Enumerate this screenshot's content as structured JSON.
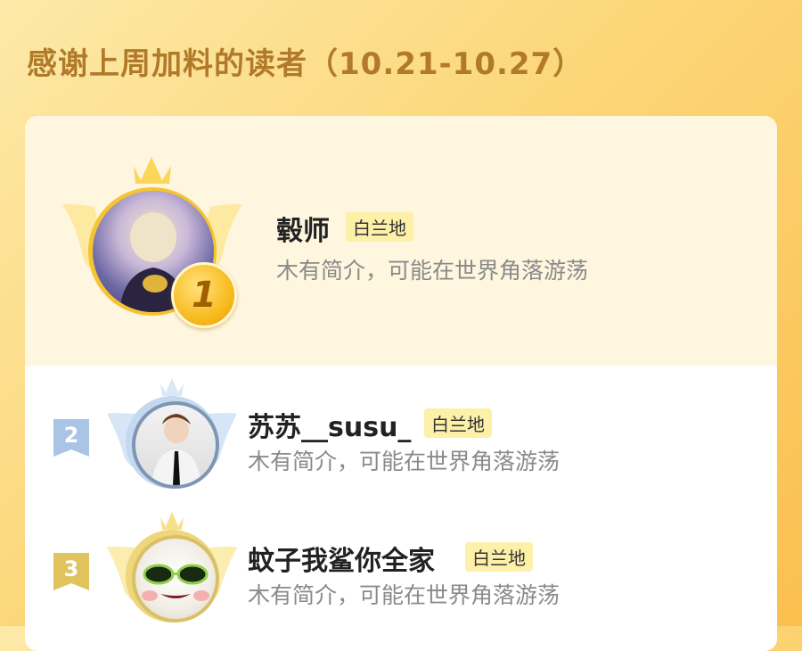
{
  "header": {
    "title": "感谢上周加料的读者（10.21-10.27）"
  },
  "readers": [
    {
      "rank": "1",
      "name": "毂师",
      "tag": "白兰地",
      "desc": "木有简介，可能在世界角落游荡"
    },
    {
      "rank": "2",
      "name": "苏苏__susu_",
      "tag": "白兰地",
      "desc": "木有简介，可能在世界角落游荡"
    },
    {
      "rank": "3",
      "name": "蚊子我鲨你全家",
      "tag": "白兰地",
      "desc": "木有简介，可能在世界角落游荡"
    }
  ],
  "colors": {
    "gold": "#f7b81b",
    "silver": "#a9c4e4",
    "bronze": "#e0c35c",
    "title": "#b07a2a",
    "tag_bg": "#fdf0a8"
  }
}
